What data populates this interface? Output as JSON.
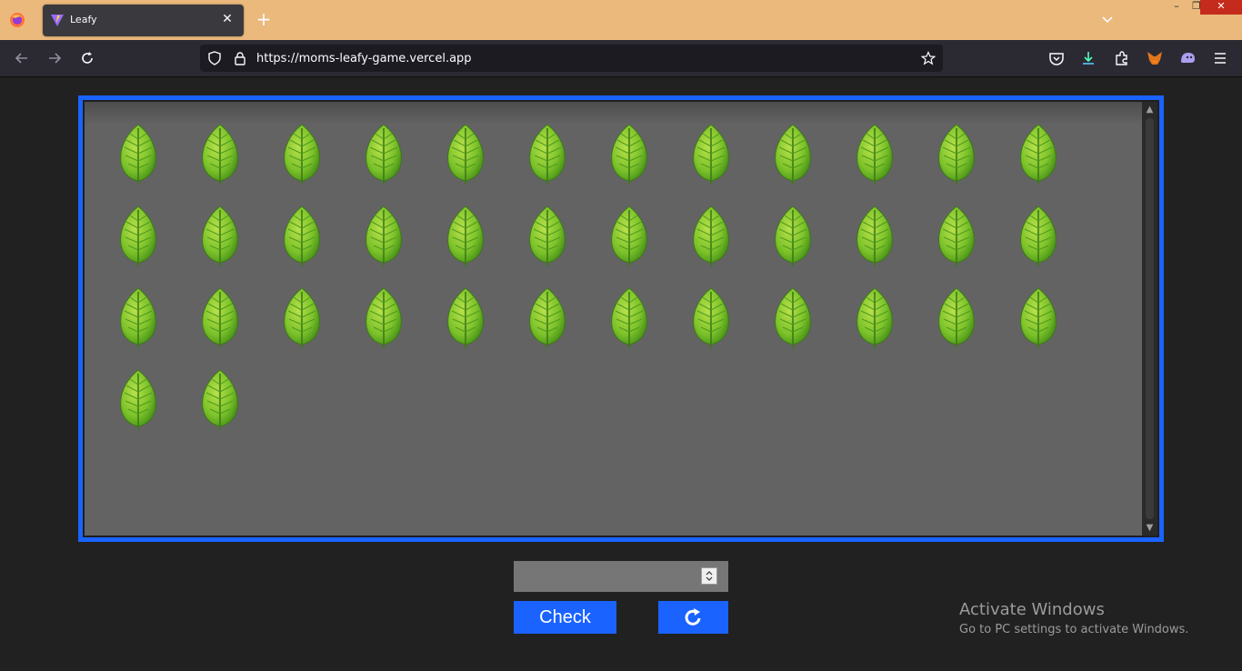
{
  "browser": {
    "tab_title": "Leafy",
    "tab_close": "✕",
    "new_tab": "+",
    "url": "https://moms-leafy-game.vercel.app",
    "accent_titlebar": "#ebb97c"
  },
  "window_controls": {
    "minimize": "–",
    "restore": "❐",
    "close": "✕"
  },
  "game": {
    "leaf_count": 38,
    "leaves_per_row": 12,
    "leaf_icon": "leaf-icon",
    "frame_color": "#1a63ff",
    "answer_value": "",
    "check_label": "Check",
    "reset_icon": "refresh-icon"
  },
  "watermark": {
    "title": "Activate Windows",
    "subtitle": "Go to PC settings to activate Windows."
  }
}
